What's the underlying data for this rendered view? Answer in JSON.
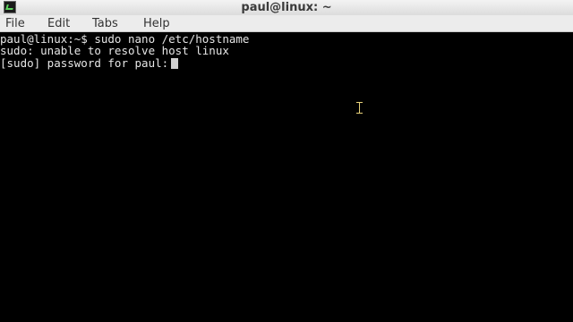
{
  "window": {
    "title": "paul@linux: ~",
    "icon": "terminal-icon"
  },
  "menu": {
    "items": [
      {
        "label": "File"
      },
      {
        "label": "Edit"
      },
      {
        "label": "Tabs"
      },
      {
        "label": "Help"
      }
    ]
  },
  "terminal": {
    "lines": [
      "paul@linux:~$ sudo nano /etc/hostname",
      "sudo: unable to resolve host linux",
      "[sudo] password for paul:"
    ],
    "cursor": "block-cursor",
    "pointer": "ibeam-icon"
  },
  "colors": {
    "background": "#000000",
    "text": "#e6e6e6",
    "titlebar": "#dcdcdc"
  }
}
